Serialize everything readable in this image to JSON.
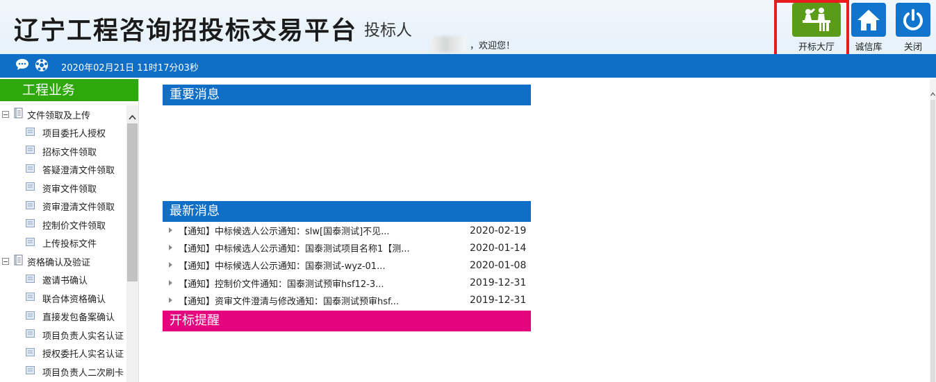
{
  "header": {
    "title": "辽宁工程咨询招投标交易平台",
    "role": "投标人",
    "welcome": "，欢迎您！",
    "buttons": {
      "bid_hall": "开标大厅",
      "credit": "诚信库",
      "close": "关闭"
    }
  },
  "infobar": {
    "datetime": "2020年02月21日 11时17分03秒"
  },
  "sidebar": {
    "title": "工程业务",
    "groups": [
      {
        "label": "文件领取及上传",
        "items": [
          "项目委托人授权",
          "招标文件领取",
          "答疑澄清文件领取",
          "资审文件领取",
          "资审澄清文件领取",
          "控制价文件领取",
          "上传投标文件"
        ]
      },
      {
        "label": "资格确认及验证",
        "items": [
          "邀请书确认",
          "联合体资格确认",
          "直接发包备案确认",
          "项目负责人实名认证",
          "授权委托人实名认证",
          "项目负责人二次刷卡"
        ]
      }
    ]
  },
  "main": {
    "important_title": "重要消息",
    "latest_title": "最新消息",
    "bidopen_title": "开标提醒",
    "latest": [
      {
        "title": "【通知】中标候选人公示通知：slw[国泰测试]不见...",
        "date": "2020-02-19"
      },
      {
        "title": "【通知】中标候选人公示通知：国泰测试项目名称1【测...",
        "date": "2020-01-14"
      },
      {
        "title": "【通知】中标候选人公示通知：国泰测试-wyz-01...",
        "date": "2020-01-08"
      },
      {
        "title": "【通知】控制价文件通知：国泰测试预审hsf12-3...",
        "date": "2019-12-31"
      },
      {
        "title": "【通知】资审文件澄清与修改通知：国泰测试预审hsf...",
        "date": "2019-12-31"
      }
    ]
  },
  "colors": {
    "brand_blue": "#0f6fc6",
    "sidebar_green": "#2ea80a",
    "bidopen_pink": "#e4047e",
    "hall_green": "#5a9b1a",
    "highlight_red": "#e81c1c"
  },
  "icons": [
    "message-icon",
    "ball-icon",
    "hall-people-icon",
    "home-icon",
    "power-icon",
    "book-icon",
    "doc-icon",
    "arrow-right-icon",
    "scroll-up-icon"
  ]
}
